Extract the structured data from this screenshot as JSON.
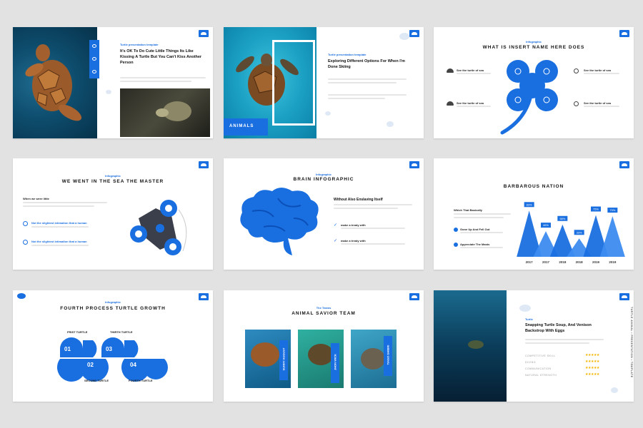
{
  "slide1": {
    "tag": "Turtle presentation template",
    "title": "It's OK To Do Cute Little Things Its Like Kissing A Turtle But You Can't Kiss Another Person"
  },
  "slide2": {
    "tag": "Turtle presentation template",
    "title": "Exploring Different Options For When I'm Done Skiing",
    "label": "ANIMALS"
  },
  "slide3": {
    "tag": "Infographic",
    "title": "WHAT IS INSERT NAME HERE DOES",
    "items": [
      "See the turtle of sea",
      "See the turtle of sea",
      "See the turtle of sea",
      "See the turtle of sea"
    ]
  },
  "slide4": {
    "tag": "Infographic",
    "title": "WE WENT IN THE SEA THE MASTER",
    "subtitle": "When we were little",
    "items": [
      "Not the slightest intimation that a human",
      "Not the slightest intimation that a human"
    ]
  },
  "slide5": {
    "tag": "Infographic",
    "title": "BRAIN INFOGRAPHIC",
    "subtitle": "Without Also Enslaving Itself",
    "items": [
      "make a treaty with",
      "make a treaty with"
    ]
  },
  "slide6": {
    "title": "BARBAROUS NATION",
    "subtitle": "Which That Basically",
    "items": [
      "Gone Up And Fell Out",
      "Appreciate The Masts"
    ]
  },
  "slide7": {
    "tag": "Infographic",
    "title": "FOURTH PROCESS TURTLE GROWTH",
    "steps": [
      "FRIST TURTLE",
      "SECOND TURTLE",
      "THIRTH TURTLE",
      "FOURTH TURTLE"
    ],
    "nums": [
      "01",
      "02",
      "03",
      "04"
    ]
  },
  "slide8": {
    "tag": "The Teams",
    "title": "ANIMAL SAVIOR TEAM",
    "members": [
      "SUNNY AUGUST",
      "JHON WICK",
      "TIAGO GHIBRI"
    ]
  },
  "slide9": {
    "tag": "Turtle",
    "title": "Snapping Turtle Soup, And Venison Backstrop With Eggs",
    "skills": [
      "COMPETITIVE SKILL",
      "DIVING",
      "COMMUNICATION",
      "NATURAL STRENGTH"
    ],
    "side": "TURTLE ANIMAL  •  PRESENTATION  •  TEMPLATE"
  },
  "chart_data": {
    "type": "area",
    "categories": [
      "2017",
      "2017",
      "2018",
      "2018",
      "2019",
      "2019"
    ],
    "values": [
      83,
      46,
      58,
      33,
      75,
      73
    ],
    "labels": [
      "83%",
      "46%",
      "58%",
      "33%",
      "75%",
      "73%"
    ],
    "ylim": [
      0,
      100
    ]
  },
  "colors": {
    "accent": "#1a6fe0",
    "dark": "#3a3f4b"
  }
}
